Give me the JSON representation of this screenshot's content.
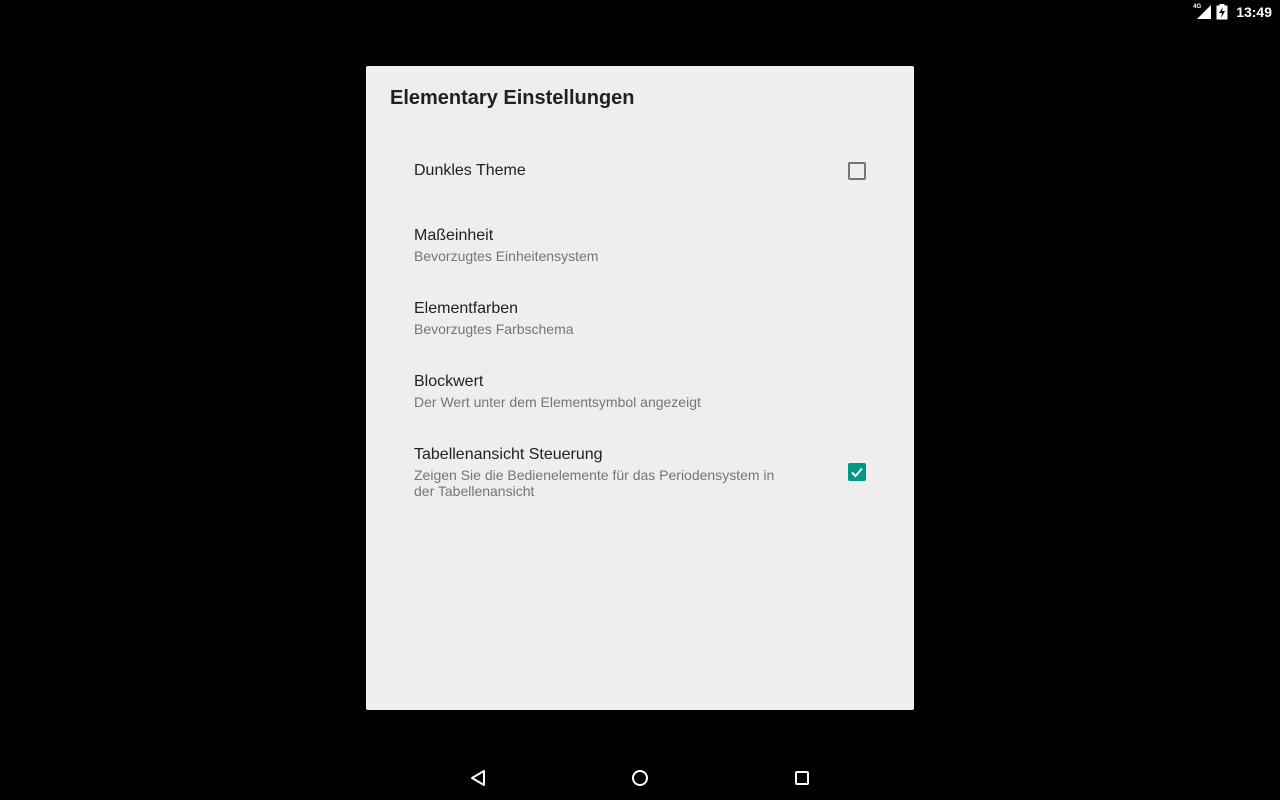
{
  "status_bar": {
    "network_label": "4G",
    "time": "13:49",
    "icons": [
      "signal-icon",
      "battery-charging-icon"
    ]
  },
  "dialog": {
    "title": "Elementary Einstellungen",
    "preferences": [
      {
        "title": "Dunkles Theme",
        "summary": "",
        "checkbox": true,
        "checked": false
      },
      {
        "title": "Maßeinheit",
        "summary": "Bevorzugtes Einheitensystem",
        "checkbox": false
      },
      {
        "title": "Elementfarben",
        "summary": "Bevorzugtes Farbschema",
        "checkbox": false
      },
      {
        "title": "Blockwert",
        "summary": "Der Wert unter dem Elementsymbol angezeigt",
        "checkbox": false
      },
      {
        "title": "Tabellenansicht Steuerung",
        "summary": "Zeigen Sie die Bedienelemente für das Periodensystem in der Tabellenansicht",
        "checkbox": true,
        "checked": true
      }
    ]
  },
  "nav_bar": {
    "buttons": [
      "back-icon",
      "home-icon",
      "recents-icon"
    ]
  },
  "colors": {
    "accent": "#009688",
    "dialog_background": "#eeeeee",
    "screen_background": "#000000"
  }
}
